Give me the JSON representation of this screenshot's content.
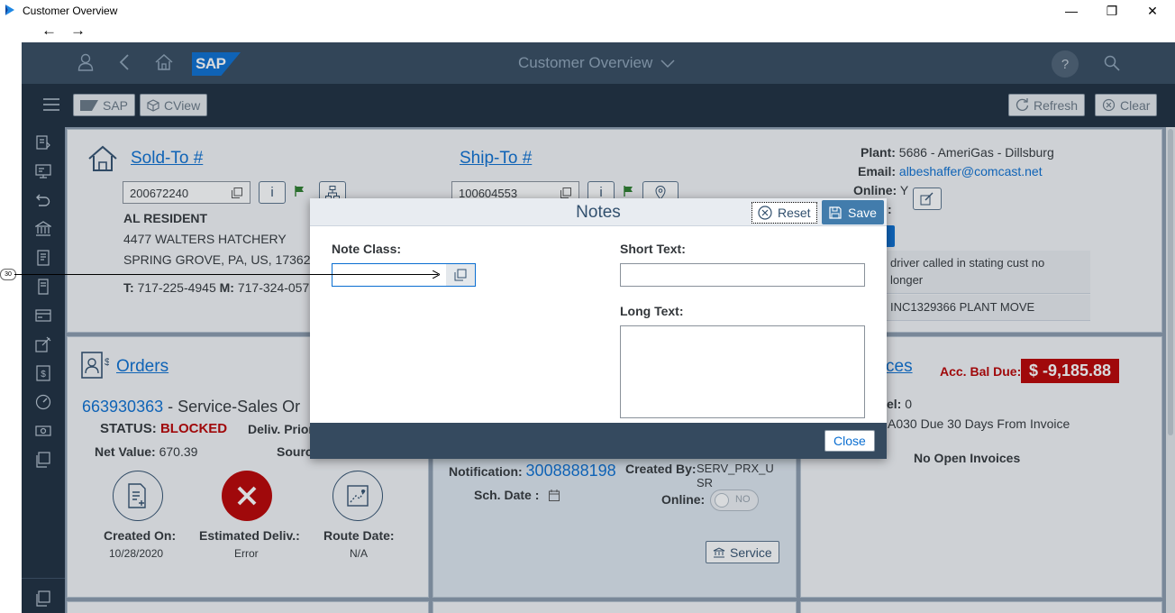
{
  "window": {
    "title": "Customer Overview",
    "minimize": "—",
    "restore": "❐",
    "close": "✕"
  },
  "nav": {
    "back": "←",
    "forward": "→"
  },
  "shell": {
    "logo_text": "SAP",
    "title": "Customer Overview",
    "help": "?"
  },
  "toolbar": {
    "sap_label": "SAP",
    "cview_label": "CView",
    "refresh_label": "Refresh",
    "clear_label": "Clear"
  },
  "sold_to": {
    "title": "Sold-To #",
    "number": "200672240",
    "info_label": "i",
    "name": "AL RESIDENT",
    "address1": "4477 WALTERS HATCHERY",
    "address2": "SPRING GROVE, PA, US, 17362-7",
    "phone_t_label": "T:",
    "phone_t": "717-225-4945",
    "phone_m_label": "M:",
    "phone_m": "717-324-057"
  },
  "ship_to": {
    "title": "Ship-To #",
    "number": "100604553",
    "info_label": "i"
  },
  "plant_info": {
    "plant_label": "Plant:",
    "plant_value": "5686 - AmeriGas - Dillsburg",
    "email_label": "Email:",
    "email_value": "albeshaffer@comcast.net",
    "online_label": "Online:",
    "online_value": "Y",
    "colon": ":",
    "note1a": "driver called in stating cust no",
    "note1b": "longer",
    "note2": "INC1329366 PLANT MOVE"
  },
  "orders": {
    "title": "Orders",
    "order_number": "663930363",
    "order_desc": " - Service-Sales Or",
    "status_label": "STATUS:",
    "status_value": "BLOCKED",
    "deliv_prior_label": "Deliv. Prior",
    "net_value_label": "Net Value:",
    "net_value": "670.39",
    "source_label": "Sourc",
    "created_on_label": "Created On:",
    "created_on_value": "10/28/2020",
    "est_deliv_label": "Estimated Deliv.:",
    "est_deliv_value": "Error",
    "route_date_label": "Route Date:",
    "route_date_value": "N/A"
  },
  "service": {
    "notification_label": "Notification:",
    "notification_value": "3008888198",
    "created_by_label": "Created By:",
    "created_by_value1": "SERV_PRX_U",
    "created_by_value2": "SR",
    "sch_date_label": "Sch. Date :",
    "online_label": "Online:",
    "online_toggle": "NO",
    "service_button": "Service"
  },
  "invoices": {
    "title_partial": "ces",
    "acc_bal_label": "Acc. Bal Due:",
    "acc_bal_value": "$ -9,185.88",
    "level_label": "el:",
    "level_value": "0",
    "terms": "A030 Due 30 Days From Invoice",
    "no_open": "No Open Invoices"
  },
  "dialog": {
    "title": "Notes",
    "reset_label": "Reset",
    "save_label": "Save",
    "note_class_label": "Note Class:",
    "note_class_value": "",
    "short_text_label": "Short Text:",
    "short_text_value": "",
    "long_text_label": "Long Text:",
    "long_text_value": "",
    "close_label": "Close"
  },
  "callout": {
    "marker": "30"
  },
  "colors": {
    "shell": "#354a5f",
    "toolbar": "#1d2d3e",
    "accent": "#0a6ed1",
    "error": "#bb0000",
    "save_button": "#427cac"
  }
}
